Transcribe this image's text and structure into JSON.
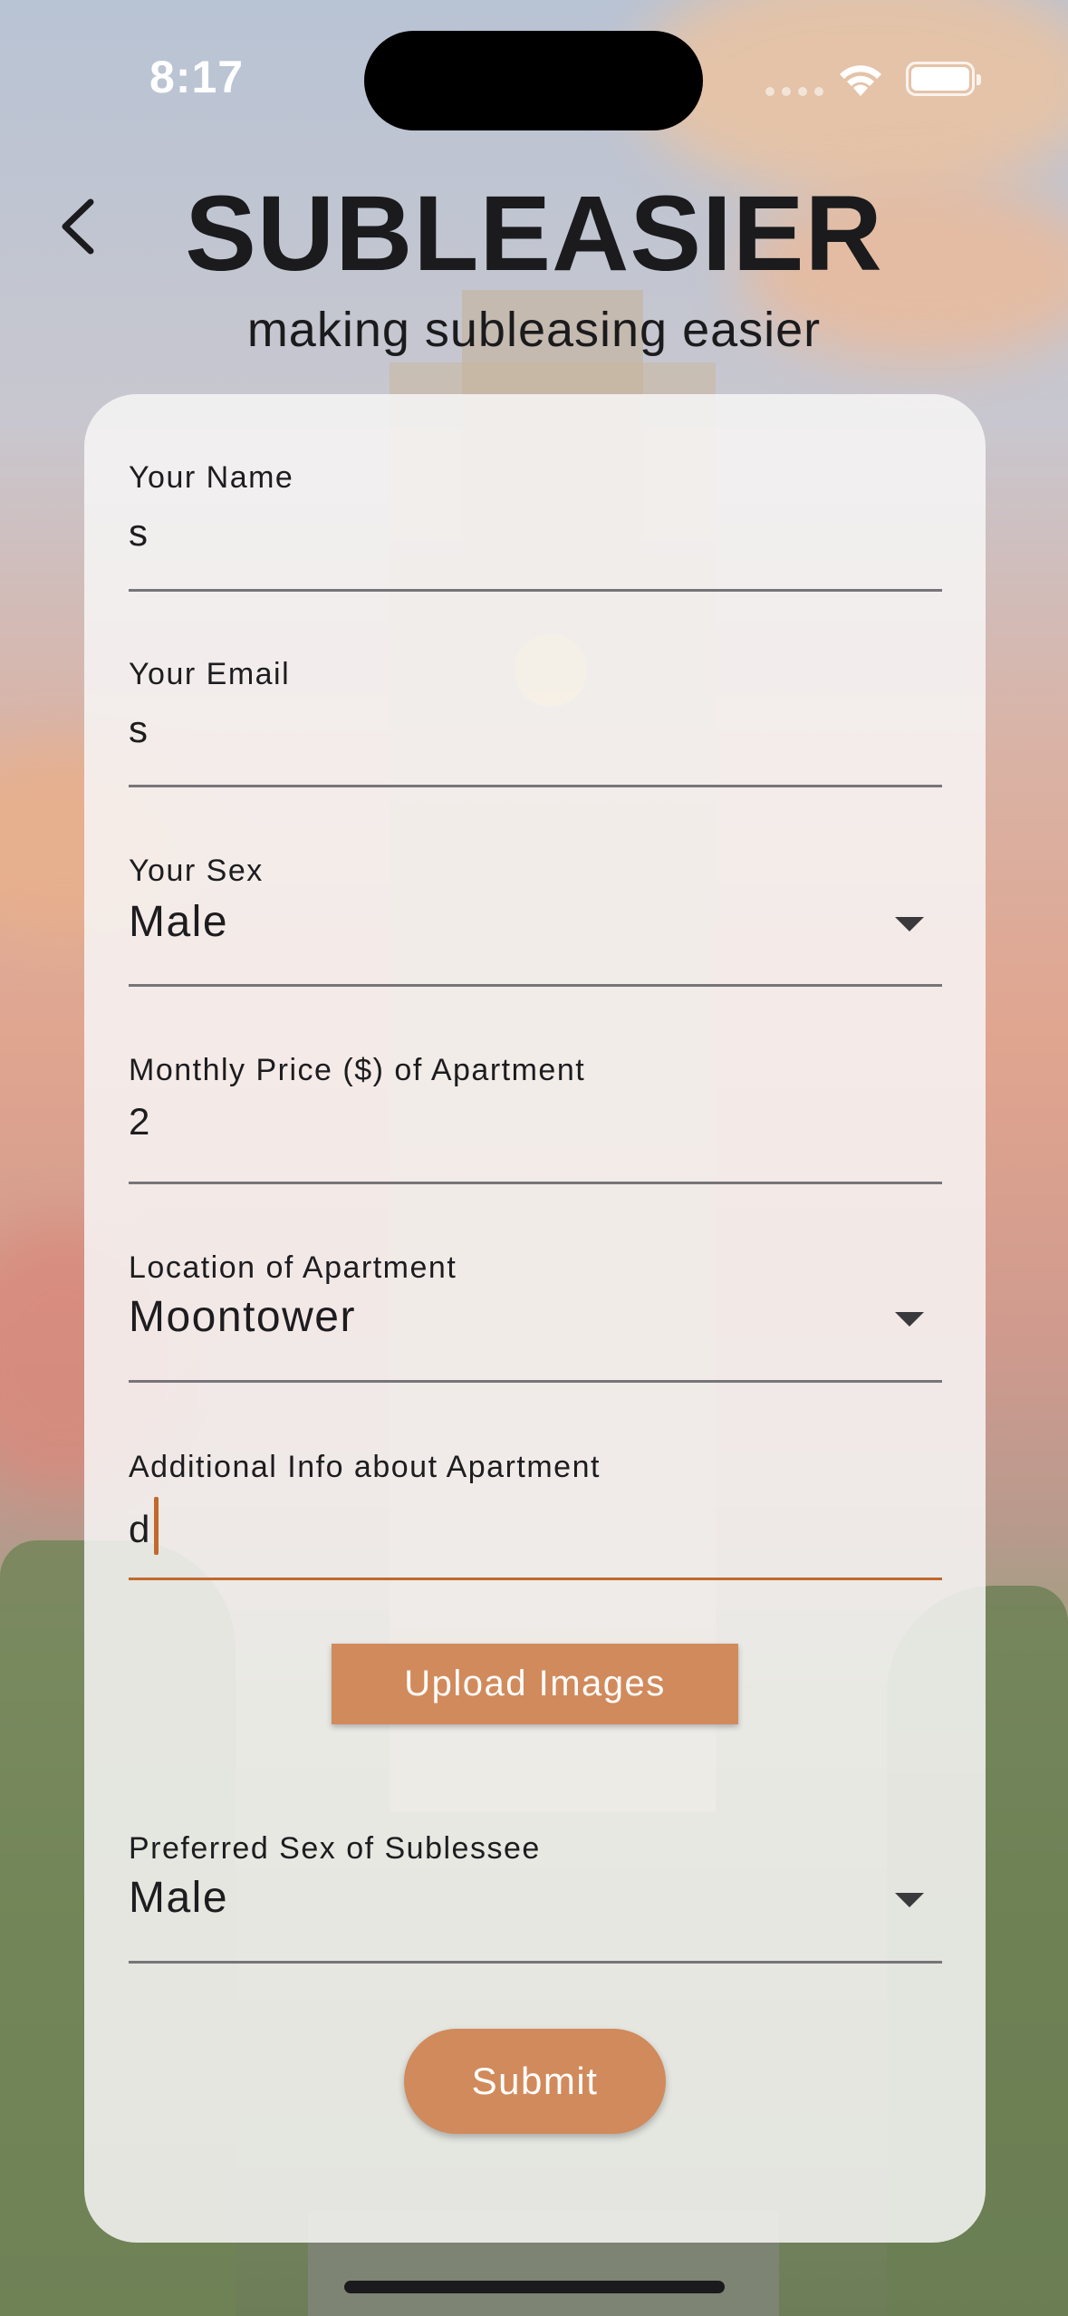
{
  "status_bar": {
    "time": "8:17"
  },
  "header": {
    "title": "SUBLEASIER",
    "subtitle": "making subleasing easier"
  },
  "form": {
    "name": {
      "label": "Your Name",
      "value": "s"
    },
    "email": {
      "label": "Your Email",
      "value": "s"
    },
    "sex": {
      "label": "Your Sex",
      "value": "Male"
    },
    "price": {
      "label": "Monthly Price ($) of Apartment",
      "value": "2"
    },
    "location": {
      "label": "Location of Apartment",
      "value": "Moontower"
    },
    "info": {
      "label": "Additional Info about Apartment",
      "value": "d"
    },
    "upload_label": "Upload Images",
    "preferred_sex": {
      "label": "Preferred Sex of Sublessee",
      "value": "Male"
    },
    "submit_label": "Submit"
  },
  "colors": {
    "accent": "#d18a5b",
    "active_underline": "#c1692c",
    "text": "#1d1c1f"
  },
  "icons": {
    "back": "chevron-left-icon",
    "dropdown": "caret-down-icon",
    "wifi": "wifi-icon",
    "battery": "battery-icon"
  }
}
